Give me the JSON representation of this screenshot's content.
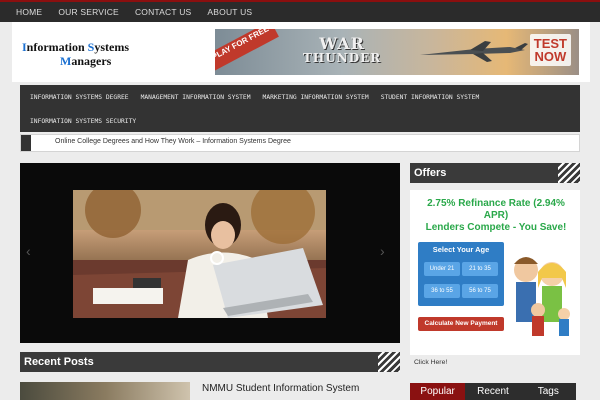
{
  "topnav": {
    "items": [
      "HOME",
      "OUR SERVICE",
      "CONTACT US",
      "ABOUT US"
    ],
    "accent": "#8b0f0f"
  },
  "logo": {
    "line1_first": "I",
    "line1_rest": "nformation ",
    "line1_second": "S",
    "line1_end": "ystems",
    "line2_first": "M",
    "line2_rest": "anagers"
  },
  "banner": {
    "ribbon": "PLAY FOR FREE",
    "game_line1": "WAR",
    "game_line2": "THUNDER",
    "cta_line1": "TEST",
    "cta_line2": "NOW"
  },
  "catnav": {
    "row1": [
      "INFORMATION SYSTEMS DEGREE",
      "MANAGEMENT INFORMATION SYSTEM",
      "MARKETING INFORMATION SYSTEM",
      "STUDENT INFORMATION SYSTEM"
    ],
    "row2": [
      "INFORMATION SYSTEMS SECURITY"
    ]
  },
  "ticker": {
    "text": "Online College Degrees and How They Work – Information Systems Degree"
  },
  "sections": {
    "offers": "Offers",
    "recent_posts": "Recent Posts"
  },
  "offer_ad": {
    "headline_line1": "2.75% Refinance Rate (2.94% APR)",
    "headline_line2": "Lenders Compete - You Save!",
    "box_title": "Select Your Age",
    "age_options": [
      "Under 21",
      "21 to 35",
      "36 to 55",
      "56 to 75"
    ],
    "calc_button": "Calculate New Payment",
    "click_here": "Click Here!"
  },
  "recent_post": {
    "title": "NMMU Student Information System"
  },
  "tabs": {
    "items": [
      "Popular",
      "Recent",
      "Tags"
    ],
    "active": "Popular",
    "active_color": "#8a1111"
  }
}
